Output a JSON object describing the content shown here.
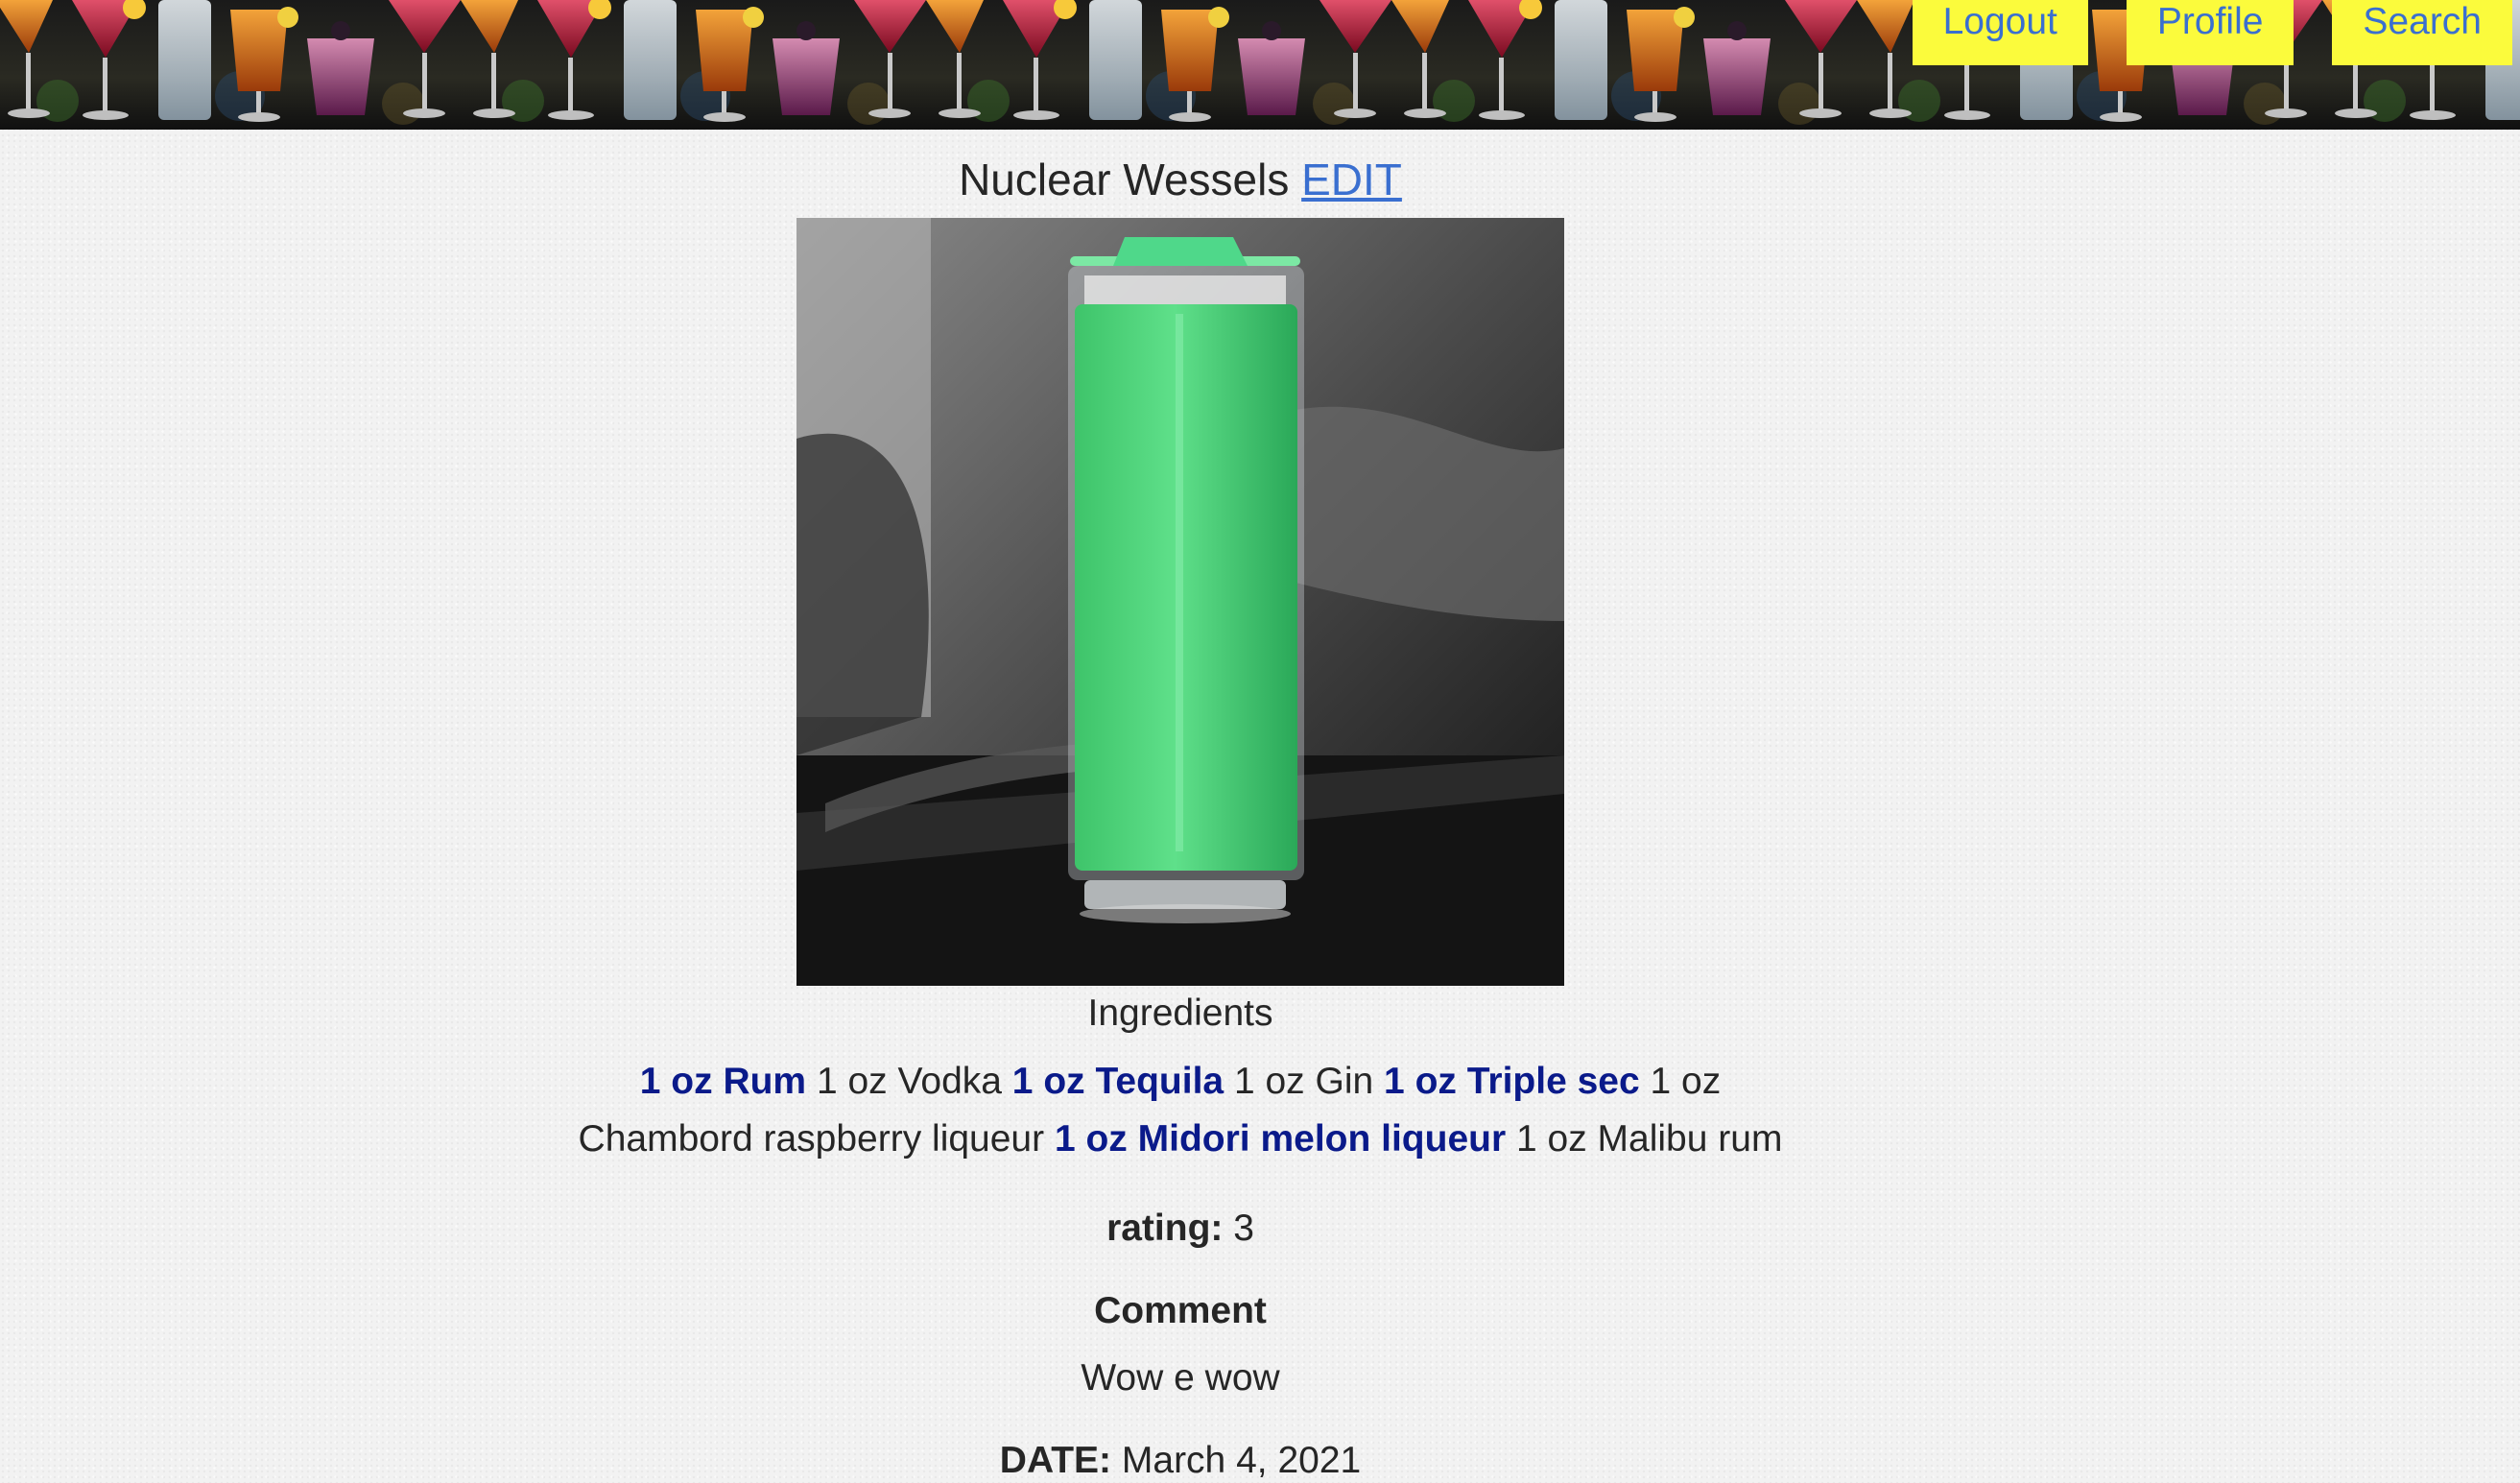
{
  "nav": {
    "logout_label": "Logout",
    "profile_label": "Profile",
    "search_label": "Search"
  },
  "banner": {
    "image": "cocktail-glasses-row"
  },
  "drink": {
    "name": "Nuclear Wessels",
    "edit_label": "EDIT",
    "photo": "green-cocktail-highball"
  },
  "ingredients": {
    "heading": "Ingredients",
    "items": [
      {
        "text": "1 oz Rum",
        "bold": true
      },
      {
        "text": "1 oz Vodka",
        "bold": false
      },
      {
        "text": "1 oz Tequila",
        "bold": true
      },
      {
        "text": "1 oz Gin",
        "bold": false
      },
      {
        "text": "1 oz Triple sec",
        "bold": true
      },
      {
        "text": "1 oz Chambord raspberry liqueur",
        "bold": false
      },
      {
        "text": "1 oz Midori melon liqueur",
        "bold": true
      },
      {
        "text": "1 oz Malibu rum",
        "bold": false
      }
    ]
  },
  "rating": {
    "label": "rating:",
    "value": "3"
  },
  "comment": {
    "heading": "Comment",
    "text": "Wow e wow"
  },
  "date": {
    "label": "DATE:",
    "value": "March 4, 2021"
  },
  "colors": {
    "nav_bg": "#fbfb3c",
    "link": "#3a6fd0",
    "bold_ingredient": "#0a1a8a"
  }
}
